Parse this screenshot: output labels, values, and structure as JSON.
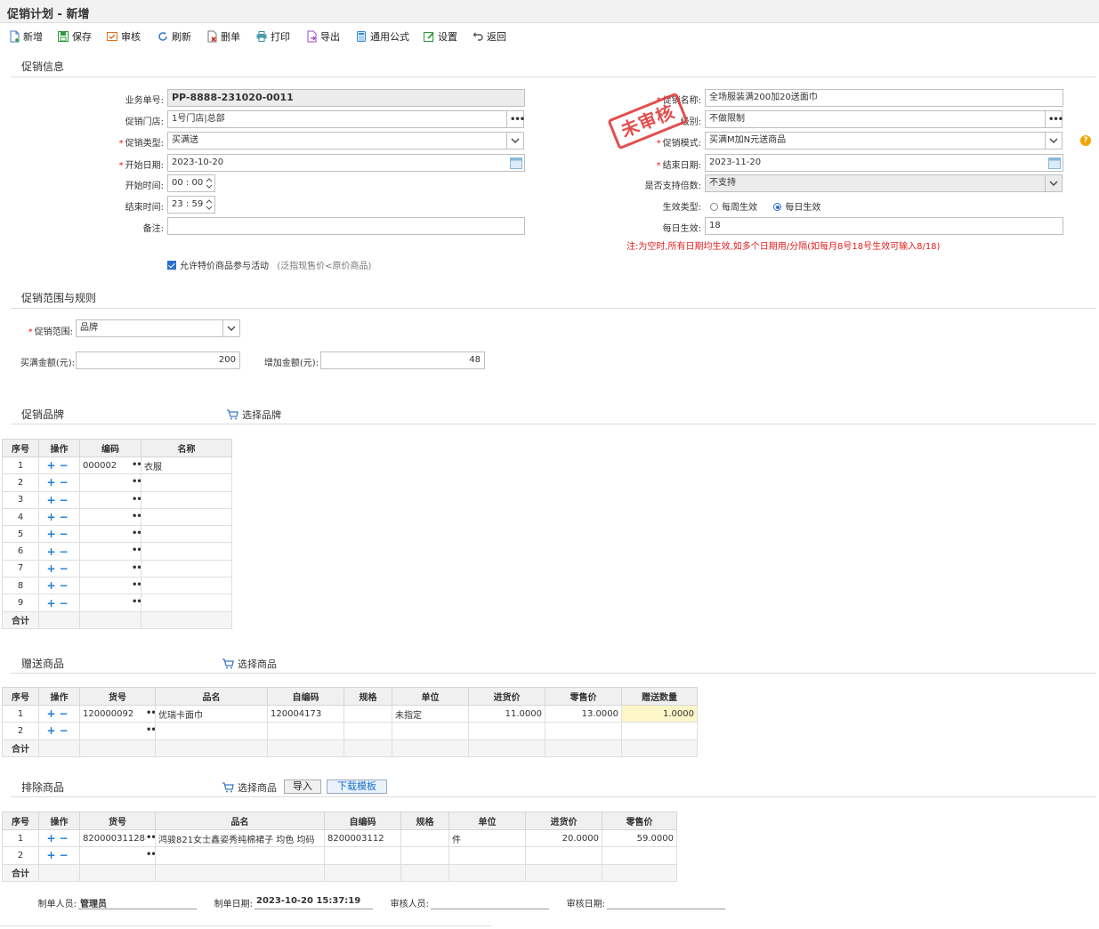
{
  "window": {
    "title": "促销计划 - 新增"
  },
  "toolbar": {
    "new": "新增",
    "save": "保存",
    "audit": "审核",
    "refresh": "刷新",
    "delete": "删单",
    "print": "打印",
    "export": "导出",
    "formula": "通用公式",
    "settings": "设置",
    "back": "返回"
  },
  "info": {
    "section_title": "促销信息",
    "stamp": "未审核",
    "doc_no_label": "业务单号:",
    "doc_no": "PP-8888-231020-0011",
    "store_label": "促销门店:",
    "store": "1号门店|总部",
    "type_label": "促销类型:",
    "type": "买满送",
    "start_date_label": "开始日期:",
    "start_date": "2023-10-20",
    "start_time_label": "开始时间:",
    "start_time": "00 : 00",
    "end_time_label": "结束时间:",
    "end_time": "23 : 59",
    "remark_label": "备注:",
    "remark": "",
    "name_label": "促销名称:",
    "name": "全场服装满200加20送面巾",
    "level_label": "级别:",
    "level": "不做限制",
    "mode_label": "促销模式:",
    "mode": "买满M加N元送商品",
    "end_date_label": "结束日期:",
    "end_date": "2023-11-20",
    "multiple_label": "是否支持倍数:",
    "multiple": "不支持",
    "effect_type_label": "生效类型:",
    "effect_weekly": "每周生效",
    "effect_daily": "每日生效",
    "daily_label": "每日生效:",
    "daily": "18",
    "daily_note": "注:为空时,所有日期均生效,如多个日期用/分隔(如每月8号18号生效可输入8/18)",
    "allow_special": "允许特价商品参与活动",
    "allow_special_hint": "(泛指现售价<原价商品)",
    "help": "?"
  },
  "scope": {
    "section_title": "促销范围与规则",
    "scope_label": "促销范围:",
    "scope": "品牌",
    "full_label": "买满金额(元):",
    "full": "200",
    "add_label": "增加金额(元):",
    "add": "48"
  },
  "brands": {
    "section_title": "促销品牌",
    "select_label": "选择品牌",
    "columns": [
      "序号",
      "操作",
      "编码",
      "名称"
    ],
    "rows": [
      {
        "no": "1",
        "code": "000002",
        "name": "衣服"
      },
      {
        "no": "2",
        "code": "",
        "name": ""
      },
      {
        "no": "3",
        "code": "",
        "name": ""
      },
      {
        "no": "4",
        "code": "",
        "name": ""
      },
      {
        "no": "5",
        "code": "",
        "name": ""
      },
      {
        "no": "6",
        "code": "",
        "name": ""
      },
      {
        "no": "7",
        "code": "",
        "name": ""
      },
      {
        "no": "8",
        "code": "",
        "name": ""
      },
      {
        "no": "9",
        "code": "",
        "name": ""
      }
    ],
    "total_label": "合计"
  },
  "gifts": {
    "section_title": "赠送商品",
    "select_label": "选择商品",
    "columns": [
      "序号",
      "操作",
      "货号",
      "品名",
      "自编码",
      "规格",
      "单位",
      "进货价",
      "零售价",
      "赠送数量"
    ],
    "rows": [
      {
        "no": "1",
        "sku": "120000092",
        "name": "优瑞卡面巾",
        "code": "120004173",
        "spec": "",
        "unit": "未指定",
        "cost": "11.0000",
        "price": "13.0000",
        "qty": "1.0000"
      },
      {
        "no": "2",
        "sku": "",
        "name": "",
        "code": "",
        "spec": "",
        "unit": "",
        "cost": "",
        "price": "",
        "qty": ""
      }
    ],
    "total_label": "合计"
  },
  "excludes": {
    "section_title": "排除商品",
    "select_label": "选择商品",
    "import_label": "导入",
    "template_label": "下载模板",
    "columns": [
      "序号",
      "操作",
      "货号",
      "品名",
      "自编码",
      "规格",
      "单位",
      "进货价",
      "零售价"
    ],
    "rows": [
      {
        "no": "1",
        "sku": "8200003112880",
        "name": "鸿骏821女士鑫姿秀纯棉裙子 均色 均码",
        "code": "8200003112",
        "spec": "",
        "unit": "件",
        "cost": "20.0000",
        "price": "59.0000"
      },
      {
        "no": "2",
        "sku": "",
        "name": "",
        "code": "",
        "spec": "",
        "unit": "",
        "cost": "",
        "price": ""
      }
    ],
    "total_label": "合计"
  },
  "footer": {
    "maker_label": "制单人员:",
    "maker": "管理员",
    "make_date_label": "制单日期:",
    "make_date": "2023-10-20 15:37:19",
    "auditor_label": "审核人员:",
    "auditor": "",
    "audit_date_label": "审核日期:",
    "audit_date": ""
  }
}
